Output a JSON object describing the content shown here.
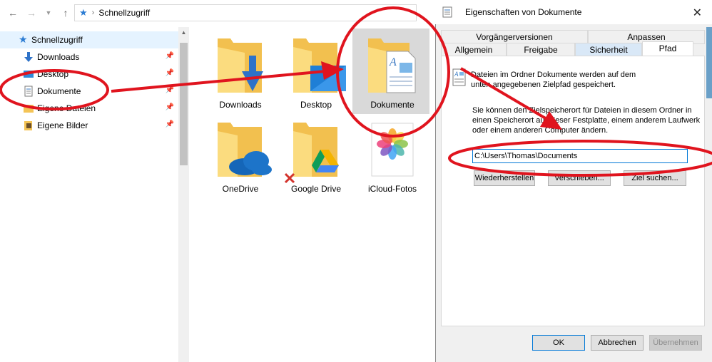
{
  "explorer": {
    "breadcrumb": "Schnellzugriff",
    "sidebar": {
      "header": "Schnellzugriff",
      "items": [
        {
          "label": "Downloads",
          "icon": "download-arrow-icon"
        },
        {
          "label": "Desktop",
          "icon": "desktop-icon"
        },
        {
          "label": "Dokumente",
          "icon": "document-icon"
        },
        {
          "label": "Eigene Dateien",
          "icon": "folder-icon"
        },
        {
          "label": "Eigene Bilder",
          "icon": "pictures-icon"
        }
      ]
    },
    "tiles": [
      {
        "label": "Downloads"
      },
      {
        "label": "Desktop"
      },
      {
        "label": "Dokumente"
      },
      {
        "label": "OneDrive"
      },
      {
        "label": "Google Drive"
      },
      {
        "label": "iCloud-Fotos"
      }
    ]
  },
  "dialog": {
    "title": "Eigenschaften von Dokumente",
    "tabs_row1": [
      "Vorgängerversionen",
      "Anpassen"
    ],
    "tabs_row2": [
      "Allgemein",
      "Freigabe",
      "Sicherheit",
      "Pfad"
    ],
    "active_tab": "Pfad",
    "info_text_1": "Dateien im Ordner Dokumente werden auf dem",
    "info_text_2": "unten angegebenen Zielpfad gespeichert.",
    "desc_1": "Sie können den Zielspeicherort für Dateien in diesem Ordner in",
    "desc_2": "einen Speicherort auf dieser Festplatte, einem anderem Laufwerk",
    "desc_3": "oder einem anderen Computer ändern.",
    "path_value": "C:\\Users\\Thomas\\Documents",
    "buttons": {
      "restore": "Wiederherstellen",
      "move": "Verschieben...",
      "find_target": "Ziel suchen...",
      "ok": "OK",
      "cancel": "Abbrechen",
      "apply": "Übernehmen"
    }
  },
  "colors": {
    "annotation_red": "#e0141e",
    "folder_yellow": "#f4c456",
    "selection": "#d9d9d9",
    "accent": "#0078d7"
  }
}
